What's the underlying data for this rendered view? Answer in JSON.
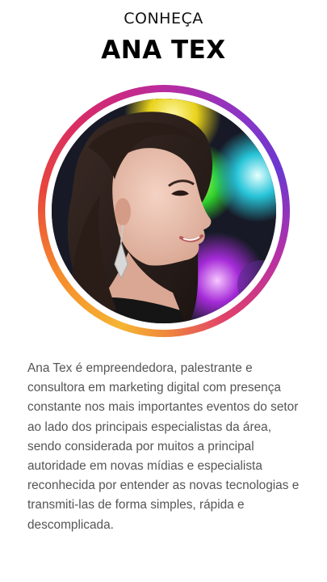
{
  "header": {
    "eyebrow": "CONHEÇA",
    "name": "ANA TEX"
  },
  "profile": {
    "photo_description_icon": "profile-photo",
    "ring_colors": [
      "#f5b532",
      "#f58a2c",
      "#e8453c",
      "#d62a6b",
      "#b92b9e",
      "#8a35c7"
    ]
  },
  "bio": {
    "text": "Ana Tex é empreendedora, palestrante e consultora em marketing digital com presença constante nos mais importantes eventos do setor ao lado dos principais especialistas da área, sendo considerada por muitos a principal autoridade em novas mídias e especialista reconhecida por entender as novas tecnologias e transmiti-las de forma simples, rápida e descomplicada."
  }
}
